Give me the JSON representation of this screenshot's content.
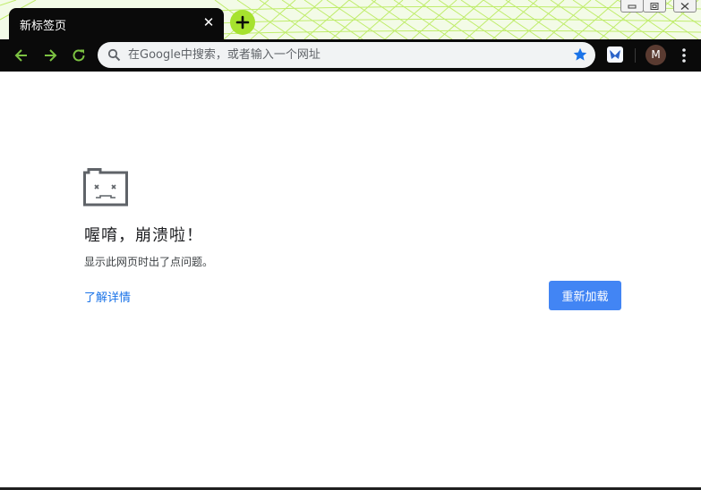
{
  "tab": {
    "title": "新标签页",
    "close_symbol": "✕"
  },
  "toolbar": {
    "back_icon": "arrow-left-icon",
    "forward_icon": "arrow-right-icon",
    "reload_icon": "reload-icon",
    "omnibox_placeholder": "在Google中搜索，或者输入一个网址",
    "bookmark_icon": "star-icon",
    "extension_icon": "extension-icon",
    "avatar_letter": "M",
    "menu_icon": "kebab-menu-icon"
  },
  "error_page": {
    "icon": "sad-tab-icon",
    "title": "喔唷，崩溃啦！",
    "message": "显示此网页时出了点问题。",
    "learn_more_label": "了解详情",
    "reload_label": "重新加载"
  },
  "colors": {
    "tabstrip_bg": "#f3fbe7",
    "tab_bg": "#0a0a0a",
    "accent_green": "#a6e22e",
    "nav_icon_green": "#7cc242",
    "link_blue": "#1a73e8",
    "button_blue": "#4285f4",
    "star_blue": "#1a73e8"
  }
}
